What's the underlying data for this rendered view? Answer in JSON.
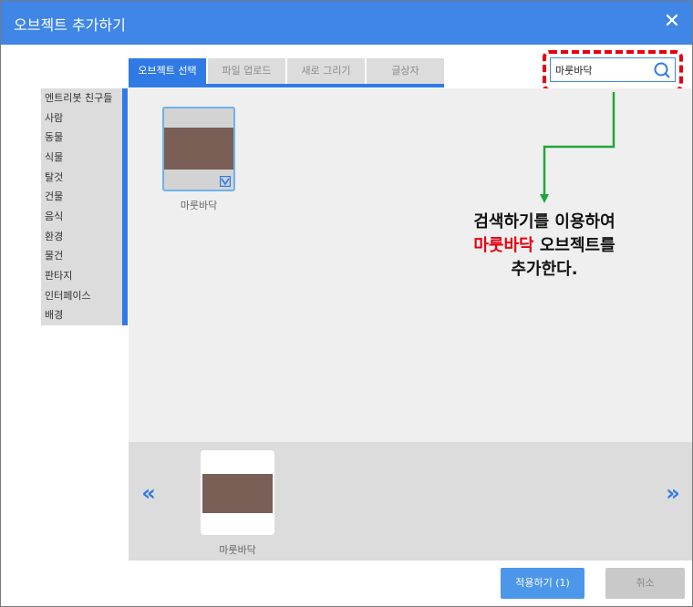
{
  "window": {
    "title": "오브젝트 추가하기",
    "close_label": "✕"
  },
  "tabs": [
    {
      "label": "오브젝트 선택",
      "active": true
    },
    {
      "label": "파일 업로드",
      "active": false
    },
    {
      "label": "새로 그리기",
      "active": false
    },
    {
      "label": "글상자",
      "active": false
    }
  ],
  "search": {
    "value": "마룻바닥",
    "icon": "search-icon"
  },
  "sidebar": {
    "items": [
      {
        "label": "엔트리봇 친구들"
      },
      {
        "label": "사람"
      },
      {
        "label": "동물"
      },
      {
        "label": "식물"
      },
      {
        "label": "탈것"
      },
      {
        "label": "건물"
      },
      {
        "label": "음식"
      },
      {
        "label": "환경"
      },
      {
        "label": "물건"
      },
      {
        "label": "판타지"
      },
      {
        "label": "인터페이스"
      },
      {
        "label": "배경"
      }
    ]
  },
  "results": [
    {
      "label": "마룻바닥",
      "selected": true
    }
  ],
  "tray": {
    "prev_label": "«",
    "next_label": "»",
    "items": [
      {
        "label": "마룻바닥"
      }
    ]
  },
  "footer": {
    "apply_label": "적용하기 (1)",
    "cancel_label": "취소"
  },
  "annotation": {
    "line1": "검색하기를 이용하여",
    "line2_red": "마룻바닥",
    "line2_rest": " 오브젝트를",
    "line3": "추가한다."
  },
  "colors": {
    "titlebar": "#3f86e6",
    "accent": "#2f7ae5",
    "highlight": "#e8000f",
    "arrow": "#22a63a",
    "thumbnail": "#7a5f57"
  }
}
